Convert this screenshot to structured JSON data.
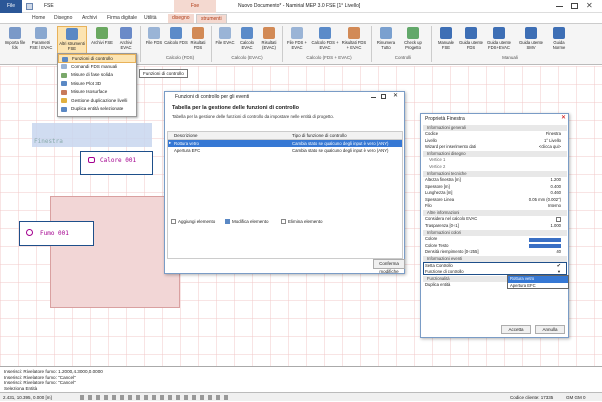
{
  "title": {
    "app_menu": "File",
    "qa_text": "FSE",
    "context_title": "Fse",
    "document_title": "Nuovo Documento* - Namirial MEP 3.0 FSE [1° Livello]"
  },
  "tabs": [
    "Home",
    "Disegno",
    "Archivi",
    "Firma digitale",
    "Utilità",
    "disegno",
    "strumenti"
  ],
  "ribbon": {
    "buttons": [
      {
        "label": "Importa file fds"
      },
      {
        "label": "Parametri FSE / EVAC"
      },
      {
        "label": "Altri strumenti FSE"
      },
      {
        "label": "Archivi FSE"
      },
      {
        "label": "Archivi EVAC"
      },
      {
        "label": "File FDS"
      },
      {
        "label": "Calcolo FDS"
      },
      {
        "label": "Risultati FDS"
      },
      {
        "label": "File EVAC"
      },
      {
        "label": "Calcolo EVAC"
      },
      {
        "label": "Risultati (EVAC)"
      },
      {
        "label": "File FDS + EVAC"
      },
      {
        "label": "Calcolo FDS + EVAC"
      },
      {
        "label": "Risultati FDS + EVAC"
      },
      {
        "label": "Rinumera Tutto"
      },
      {
        "label": "Check up Progetto"
      },
      {
        "label": "Manuale FSE"
      },
      {
        "label": "Guida utente FDS"
      },
      {
        "label": "Guida utente FDS+EVAC"
      },
      {
        "label": "Guida utente SMV"
      },
      {
        "label": "Guida Norme"
      }
    ],
    "groups": [
      "Calcolo (FDS)",
      "Calcolo (EVAC)",
      "Calcolo (FDS + EVAC)",
      "Controlli",
      "Manuali"
    ]
  },
  "menu": {
    "items": [
      "Funzioni di controllo",
      "Comandi FDS manuali",
      "Misure di fase solida",
      "Misure Plot 3D",
      "Misure Isosurface",
      "Gestione duplicazione livelli",
      "Duplica entità selezionate"
    ],
    "tooltip": "Funzioni di controllo"
  },
  "canvas": {
    "labels": [
      "Finestra",
      "Calore 001",
      "Fumo 001"
    ]
  },
  "dialog": {
    "title": "Funzioni di controllo per gli eventi",
    "heading": "Tabella per la gestione delle funzioni di controllo",
    "subheading": "Tabella per la gestione delle funzioni di controllo da impostare nelle entità di progetto.",
    "columns": [
      "Descrizione",
      "Tipo di funzione di controllo"
    ],
    "rows": [
      {
        "desc": "Rottura vetro",
        "type": "Cambia stato se qualcuno degli input è vero (ANY)"
      },
      {
        "desc": "Apertura EFC",
        "type": "Cambia stato se qualcuno degli input è vero (ANY)"
      }
    ],
    "buttons": {
      "add": "Aggiungi elemento",
      "edit": "Modifica elemento",
      "delete": "Elimina elemento",
      "confirm": "Conferma modifiche"
    }
  },
  "props": {
    "title": "Proprietà Finestra",
    "sections": {
      "general": "Informazioni generali",
      "drawing": "Informazioni disegno",
      "technical": "Informazioni tecniche",
      "other": "Altre informazioni",
      "colors": "Informazioni colori",
      "events": "Informazioni eventi",
      "functions": "Funzionalità"
    },
    "general": [
      {
        "k": "Codice",
        "v": "Finestra"
      },
      {
        "k": "Livello",
        "v": "1° Livello"
      },
      {
        "k": "Wizard per inserimento dati",
        "v": "<clicca qui>"
      }
    ],
    "drawing": [
      {
        "k": "Vertice 1",
        "v": ""
      },
      {
        "k": "Vertice 2",
        "v": ""
      }
    ],
    "technical": [
      {
        "k": "Altezza finestra [m]",
        "v": "1.200"
      },
      {
        "k": "Spessore [m]",
        "v": "0.400"
      },
      {
        "k": "Lunghezza [m]",
        "v": "0.460"
      },
      {
        "k": "Spessore Linea",
        "v": "0.05 mm (0.002\")"
      },
      {
        "k": "Filo",
        "v": "Interno"
      }
    ],
    "other": [
      {
        "k": "Considera nel calcolo EVAC",
        "v": ""
      },
      {
        "k": "Trasparenza [0÷1]",
        "v": "1.000"
      }
    ],
    "colors": [
      {
        "k": "Colore",
        "v": ""
      },
      {
        "k": "Colore Testo",
        "v": ""
      },
      {
        "k": "Densità riempimento [0÷255]",
        "v": "40"
      }
    ],
    "events": [
      {
        "k": "Setta Controllo",
        "v": ""
      },
      {
        "k": "Funzione di controllo",
        "v": ""
      }
    ],
    "functions": [
      {
        "k": "Duplica entità",
        "v": ""
      }
    ],
    "dropdown": [
      "Rottura vetro",
      "Apertura EFC"
    ],
    "buttons": {
      "ok": "Accetta",
      "cancel": "Annulla"
    }
  },
  "cmdline": {
    "lines": [
      "Inserisci: Rivelatore fumo: 1.2000,4.3000,0.0000",
      "Inserisci: Rivelatore fumo: \"Cancel\"",
      "Inserisci: Rivelatore fumo: \"Cancel\""
    ],
    "prompt": "Seleziona Entità"
  },
  "status": {
    "coords": "2.431, 10.395, 0.000 [m]",
    "code": "Codice cliente: 17335",
    "gpu": "GM GM 0"
  }
}
